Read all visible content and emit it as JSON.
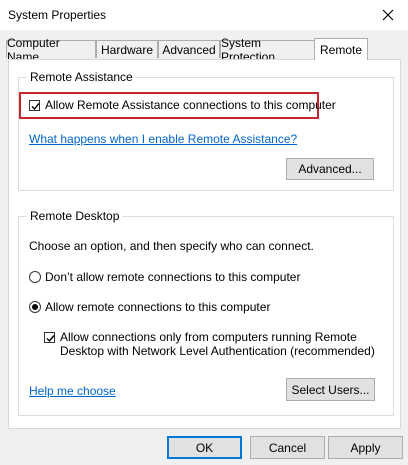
{
  "window": {
    "title": "System Properties"
  },
  "tabs": [
    {
      "label": "Computer Name",
      "active": false
    },
    {
      "label": "Hardware",
      "active": false
    },
    {
      "label": "Advanced",
      "active": false
    },
    {
      "label": "System Protection",
      "active": false
    },
    {
      "label": "Remote",
      "active": true
    }
  ],
  "remote_assistance": {
    "legend": "Remote Assistance",
    "checkbox_label": "Allow Remote Assistance connections to this computer",
    "checked": true,
    "link": "What happens when I enable Remote Assistance?",
    "advanced_button": "Advanced..."
  },
  "remote_desktop": {
    "legend": "Remote Desktop",
    "instruction": "Choose an option, and then specify who can connect.",
    "option_dont_allow": "Don’t allow remote connections to this computer",
    "option_allow": "Allow remote connections to this computer",
    "selected_option": "allow",
    "nla_line1": "Allow connections only from computers running Remote",
    "nla_line2": "Desktop with Network Level Authentication (recommended)",
    "nla_checked": true,
    "help_link": "Help me choose",
    "select_users_button": "Select Users..."
  },
  "footer": {
    "ok": "OK",
    "cancel": "Cancel",
    "apply": "Apply"
  },
  "colors": {
    "highlight": "#c4262e",
    "link": "#0066cc",
    "default_button": "#0078d7"
  }
}
